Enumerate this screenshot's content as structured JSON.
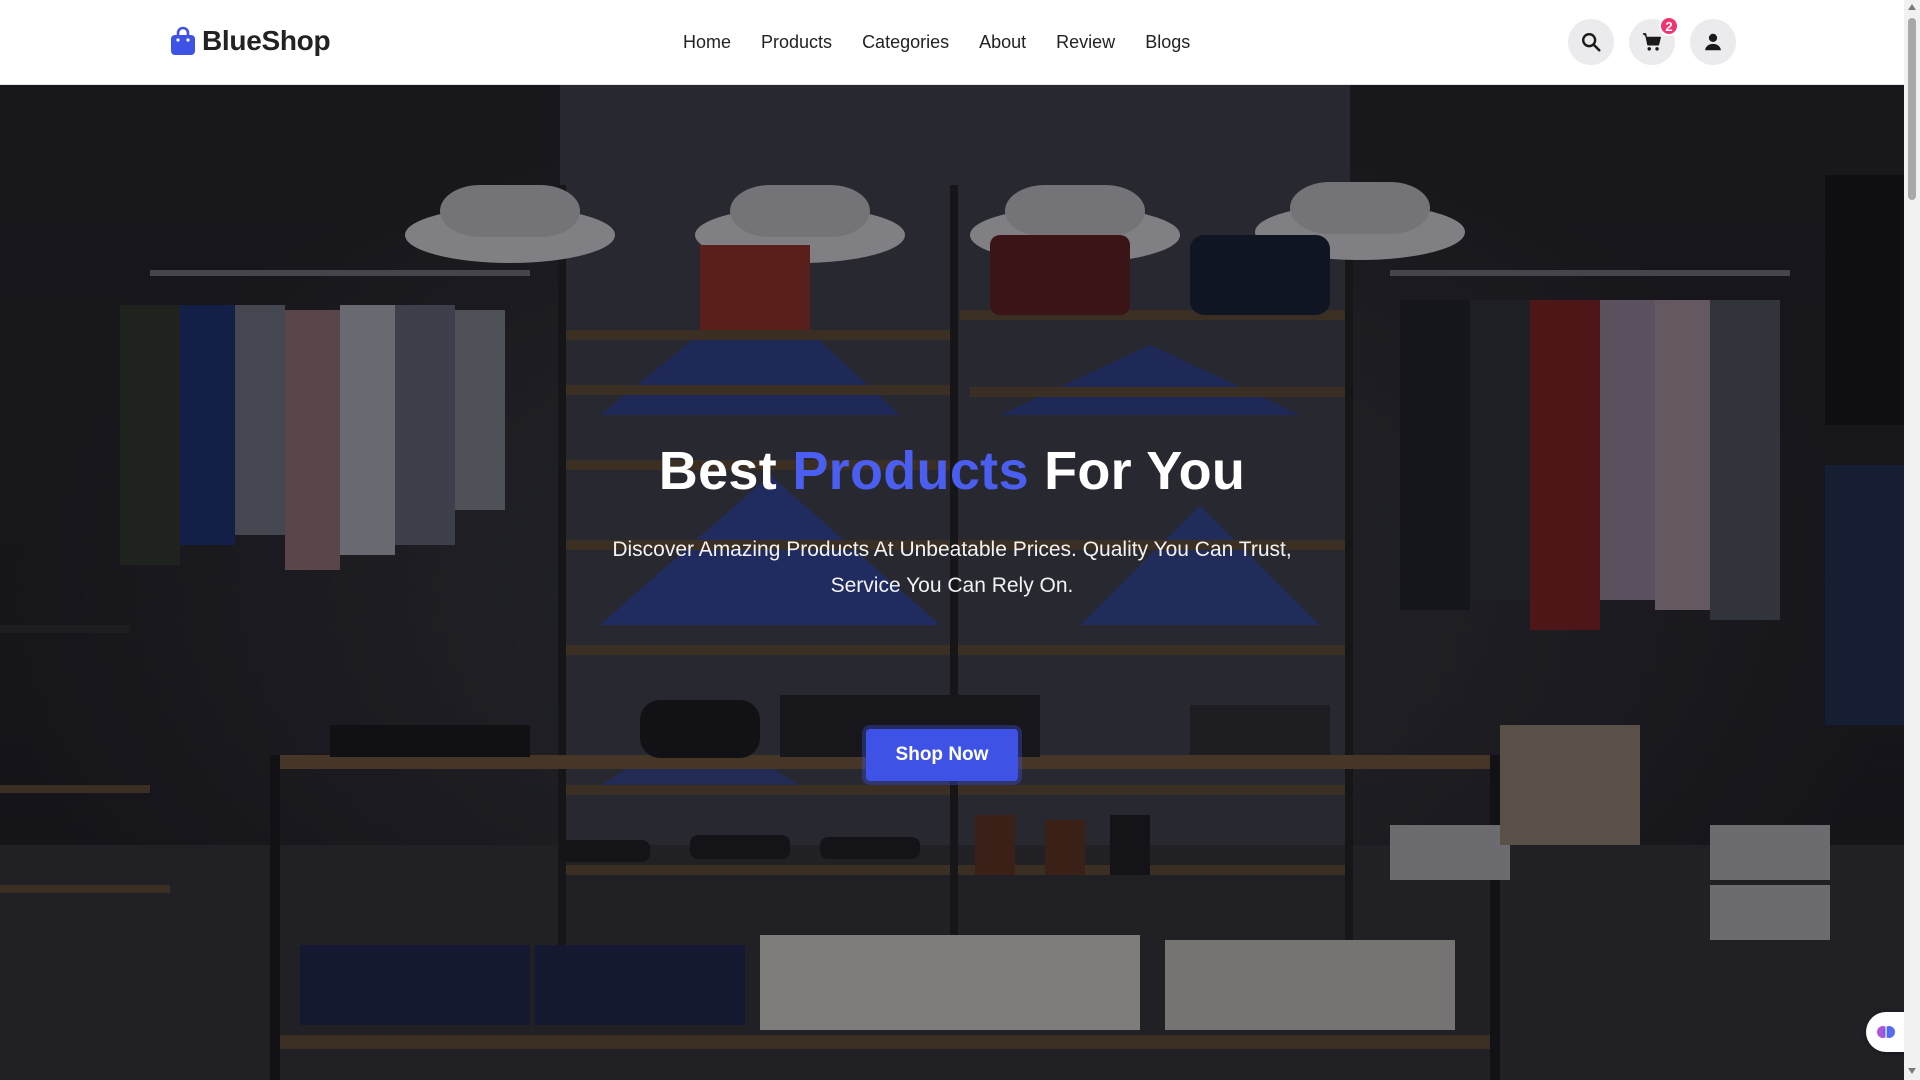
{
  "brand": {
    "name": "BlueShop"
  },
  "nav": {
    "items": [
      {
        "label": "Home"
      },
      {
        "label": "Products"
      },
      {
        "label": "Categories"
      },
      {
        "label": "About"
      },
      {
        "label": "Review"
      },
      {
        "label": "Blogs"
      }
    ]
  },
  "actions": {
    "search_icon": "search-icon",
    "cart_icon": "cart-icon",
    "cart_count": "2",
    "user_icon": "user-icon"
  },
  "hero": {
    "title_part1": "Best ",
    "title_accent": "Products",
    "title_part2": " For You",
    "subtitle": "Discover Amazing Products At Unbeatable Prices. Quality You Can Trust, Service You Can Rely On.",
    "cta_label": "Shop Now"
  },
  "colors": {
    "accent": "#4a5ef0",
    "button": "#3e53e6",
    "badge": "#f0346d"
  }
}
